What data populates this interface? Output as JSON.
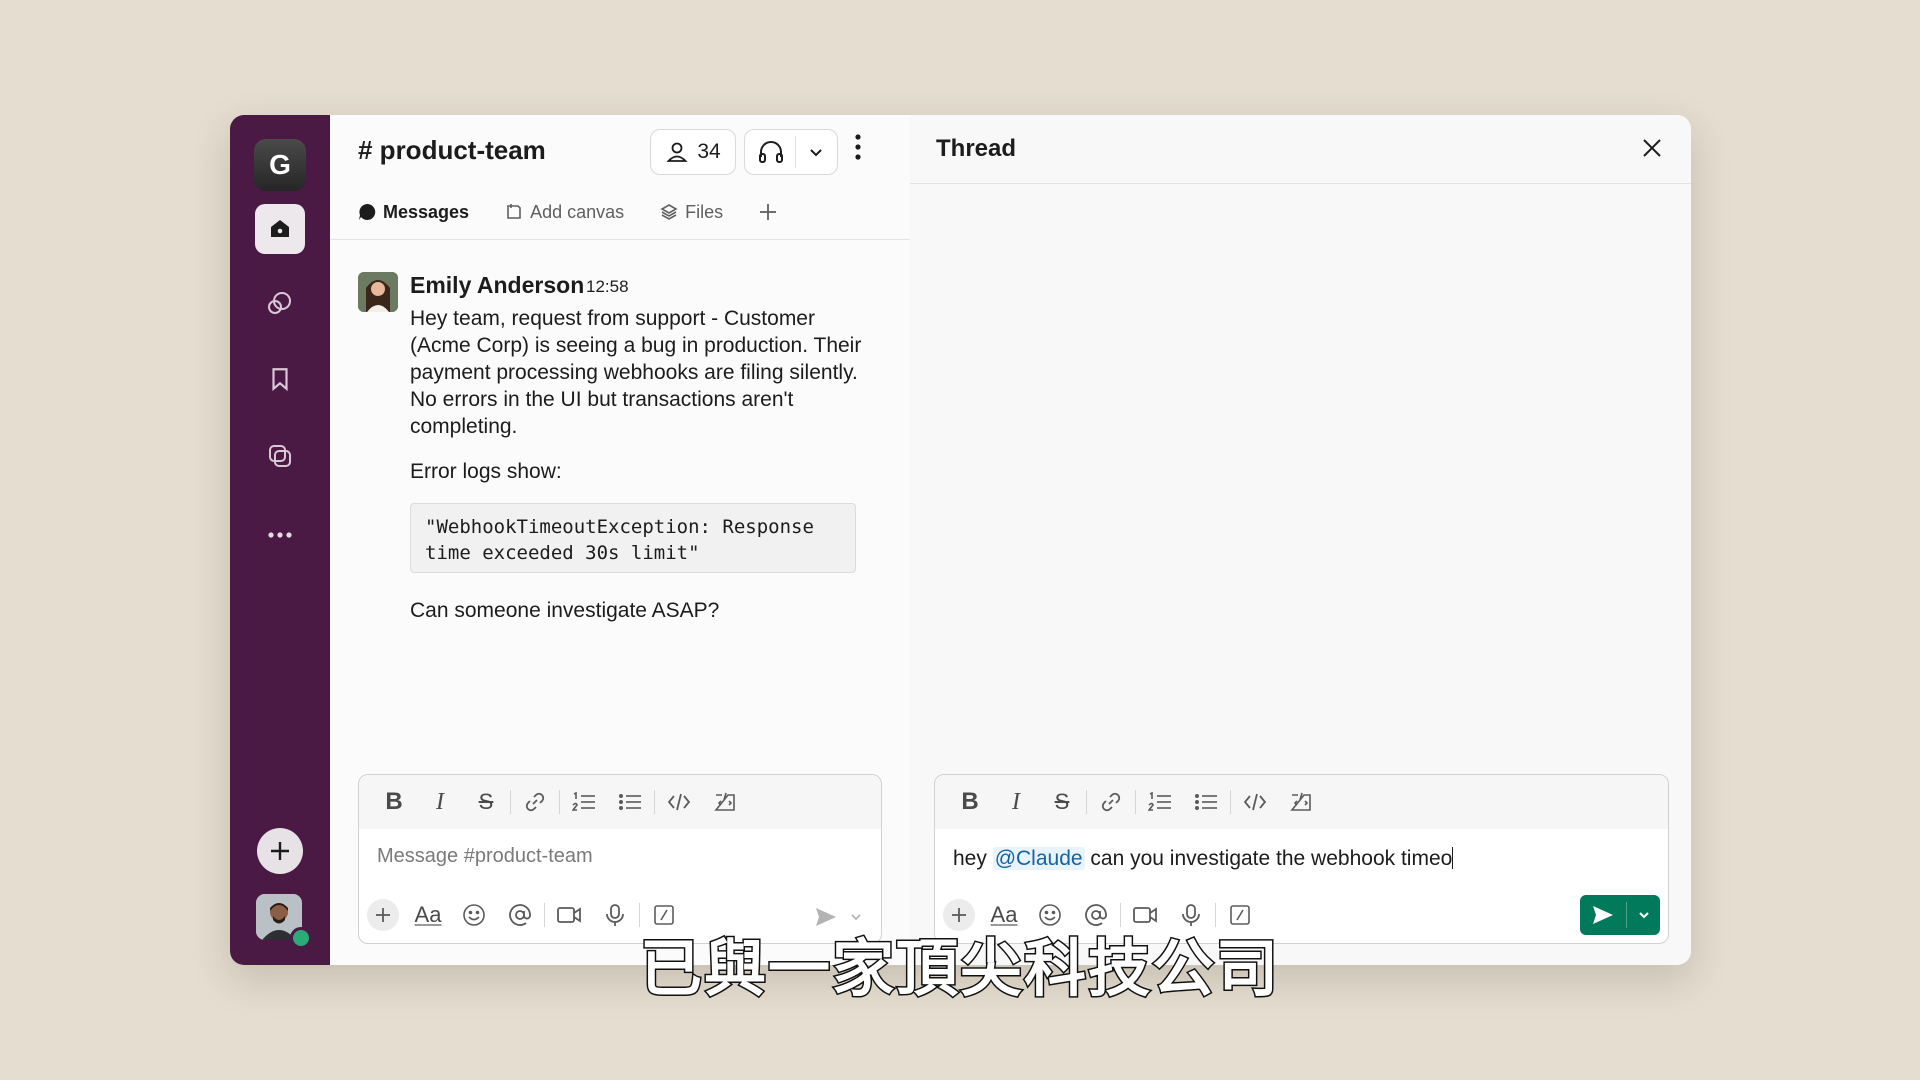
{
  "workspace": {
    "initial": "G"
  },
  "channel": {
    "name": "# product-team",
    "member_count": "34",
    "tabs": [
      {
        "label": "Messages"
      },
      {
        "label": "Add canvas"
      },
      {
        "label": "Files"
      }
    ]
  },
  "message": {
    "author": "Emily Anderson",
    "time": "12:58",
    "paragraph1": "Hey team, request from support - Customer (Acme Corp) is seeing a bug in production. Their payment processing webhooks are filing silently. No errors in the UI but transactions aren't completing.",
    "paragraph2": "Error logs show:",
    "code_line1": "\"WebhookTimeoutException: Response",
    "code_line2": "time exceeded 30s limit\"",
    "followup": "Can someone investigate ASAP?"
  },
  "composer": {
    "placeholder": "Message #product-team"
  },
  "thread": {
    "title": "Thread",
    "composer_prefix": "hey ",
    "composer_mention": "@Claude",
    "composer_suffix": " can you investigate the webhook timeo"
  },
  "subtitle": "已與一家頂尖科技公司",
  "colors": {
    "rail": "#4a1a45",
    "send": "#007a5a",
    "mention": "#1264a3",
    "presence": "#2bac76"
  }
}
